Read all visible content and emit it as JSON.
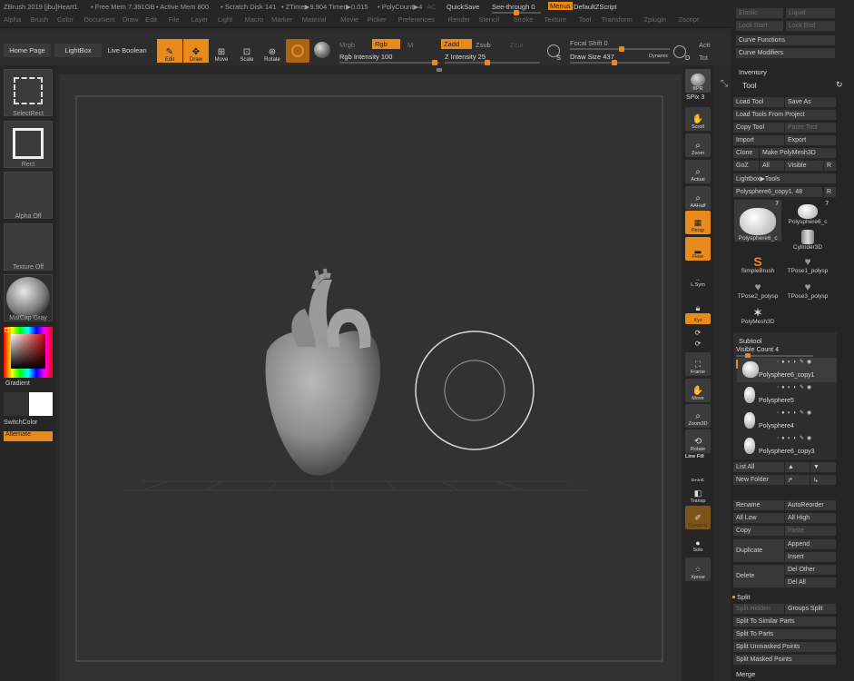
{
  "titlebar": {
    "app": "ZBrush 2019 [jbu]Heart1",
    "free_mem": "• Free Mem 7.391GB",
    "active_mem": "• Active Mem 800",
    "scratch": "• Scratch Disk 141",
    "ztime": "• ZTime▶9.904 Timer▶0.015",
    "polycount": "• PolyCount▶4",
    "ac": "AC",
    "quicksave": "QuickSave",
    "seethrough": "See-through  0",
    "menus": "Menus",
    "script": "DefaultZScript"
  },
  "menubar": [
    "Alpha",
    "Brush",
    "Color",
    "Document",
    "Draw",
    "Edit",
    "File",
    "Layer",
    "Light",
    "Macro",
    "Marker",
    "Material",
    "Movie",
    "Picker",
    "Preferences",
    "Render",
    "Stencil",
    "Stroke",
    "Texture",
    "Tool",
    "Transform",
    "Zplugin",
    "Zscript"
  ],
  "toolbar": {
    "home": "Home Page",
    "lightbox": "LightBox",
    "liveboolean": "Live Boolean",
    "edit": "Edit",
    "draw": "Draw",
    "move": "Move",
    "scale": "Scale",
    "rotate": "Rotate",
    "mrgb": "Mrgb",
    "rgb": "Rgb",
    "m": "M",
    "rgb_intensity": "Rgb Intensity 100",
    "zadd": "Zadd",
    "zsub": "Zsub",
    "zcut": "Zcut",
    "z_intensity": "Z Intensity 25",
    "focal_shift": "Focal Shift 0",
    "draw_size": "Draw Size 437",
    "dynamic": "Dynamic",
    "s": "S",
    "d": "D",
    "acti": "Acti",
    "tot": "Tot"
  },
  "left": {
    "selectrect": "SelectRect",
    "rect": "Rect",
    "alpha": "Alpha Off",
    "texture": "Texture Off",
    "matcap": "MatCap Gray",
    "gradient": "Gradient",
    "switchcolor": "SwitchColor",
    "alternate": "Alternate"
  },
  "shelf": {
    "bpr": "BPR",
    "spix": "SPix 3",
    "scroll": "Scroll",
    "zoom": "Zoom",
    "actual": "Actual",
    "aahalf": "AAHalf",
    "persp": "Persp",
    "floor": "Floor",
    "lsym": "L.Sym",
    "xyz": "Xyz",
    "frame": "Frame",
    "move": "Move",
    "zoom3d": "Zoom3D",
    "rotate": "Rotate",
    "linefill": "Line Fill",
    "polyf": "PolyF",
    "transp": "Transp",
    "dynamic": "Dynamic",
    "solo": "Solo",
    "xpose": "Xpose"
  },
  "right": {
    "top_items": [
      "Elastic",
      "Liquid",
      "Lock Start",
      "Lock End",
      "Curve Functions",
      "Curve Modifiers"
    ],
    "inventory": "Inventory",
    "tool": "Tool",
    "load_tool": "Load Tool",
    "save_as": "Save As",
    "load_from_project": "Load Tools From Project",
    "copy_tool": "Copy Tool",
    "paste_tool": "Paste Tool",
    "import": "Import",
    "export": "Export",
    "clone": "Clone",
    "make_polymesh": "Make PolyMesh3D",
    "goz": "GoZ",
    "all": "All",
    "visible": "Visible",
    "r": "R",
    "lightbox_tools": "Lightbox▶Tools",
    "current_tool": "Polysphere6_copy1. 48",
    "thumbs": [
      {
        "label": "Polysphere6_c",
        "badge": "7"
      },
      {
        "label": "Polysphere6_c",
        "badge": "7"
      },
      {
        "label": "Cylinder3D",
        "badge": ""
      },
      {
        "label": "SimpleBrush",
        "badge": ""
      },
      {
        "label": "TPose1_polysp",
        "badge": ""
      },
      {
        "label": "TPose2_polysp",
        "badge": ""
      },
      {
        "label": "TPose3_polysp",
        "badge": ""
      },
      {
        "label": "PolyMesh3D",
        "badge": ""
      }
    ],
    "subtool": "Subtool",
    "visible_count": "Visible Count 4",
    "subtools": [
      "Polysphere6_copy1",
      "Polysphere5",
      "Polysphere4",
      "Polysphere6_copy3"
    ],
    "list_all": "List All",
    "new_folder": "New Folder",
    "rename": "Rename",
    "autoreorder": "AutoReorder",
    "all_low": "All Low",
    "all_high": "All High",
    "copy": "Copy",
    "paste": "Paste",
    "duplicate": "Duplicate",
    "append": "Append",
    "insert": "Insert",
    "delete": "Delete",
    "del_other": "Del Other",
    "del_all": "Del All",
    "split": "Split",
    "split_hidden": "Split Hidden",
    "groups_split": "Groups Split",
    "split_similar": "Split To Similar Parts",
    "split_parts": "Split To Parts",
    "split_unmasked": "Split Unmasked Points",
    "split_masked": "Split Masked Points",
    "merge": "Merge"
  },
  "colors": {
    "accent": "#e88b1c",
    "background": "#2b2b2b"
  }
}
